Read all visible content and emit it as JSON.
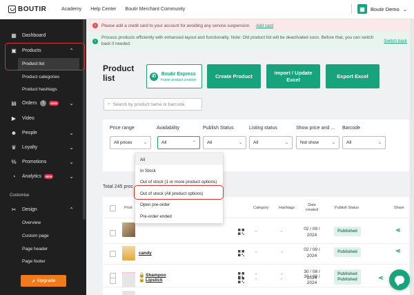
{
  "app": {
    "logo_text": "BOUTIR",
    "account_name": "Boutir Demo",
    "account_icon": "store-icon",
    "accent_color": "#17a37c"
  },
  "topnav": [
    "Academy",
    "Help Center",
    "Boutir Merchant Community"
  ],
  "sidebar": {
    "items": [
      {
        "label": "Dashboard",
        "icon": "dashboard-icon"
      },
      {
        "label": "Products",
        "icon": "products-icon"
      },
      {
        "label": "Orders",
        "icon": "orders-icon",
        "badge": "NEW"
      },
      {
        "label": "Video",
        "icon": "video-icon"
      },
      {
        "label": "People",
        "icon": "people-icon"
      },
      {
        "label": "Loyalty",
        "icon": "loyalty-icon"
      },
      {
        "label": "Promotions",
        "icon": "promotions-icon"
      },
      {
        "label": "Analytics",
        "icon": "analytics-icon",
        "badge": "NEW"
      },
      {
        "label": "Design",
        "icon": "design-icon"
      }
    ],
    "product_sub": [
      "Product list",
      "Product categories",
      "Product hashtags"
    ],
    "section_label": "Customise",
    "design_sub": [
      "Overview",
      "Custom page",
      "Page header",
      "Page footer"
    ],
    "upgrade_label": "Upgrade"
  },
  "notices": {
    "credit": "Please add a credit card to your account for avoiding any service suspension.",
    "credit_link": "Add card",
    "process": "Process products efficiently with enhanced layout and functionality. Note: Old product list will be deactivated soon. Before that, you can switch back if needed.",
    "process_link": "Switch back"
  },
  "page": {
    "title": "Product list"
  },
  "buttons": {
    "wa_title": "Boutir Express",
    "wa_sub": "Faster product creation",
    "create": "Create Product",
    "import": "Import / Update Excel",
    "export": "Export Excel"
  },
  "search": {
    "placeholder": "Search by product name or barcode."
  },
  "filters": [
    {
      "label": "Price range",
      "value": "All prices"
    },
    {
      "label": "Availability",
      "value": "All"
    },
    {
      "label": "Publish Status",
      "value": "All"
    },
    {
      "label": "Listing status",
      "value": "All"
    },
    {
      "label": "Show price and ...",
      "value": "Not show"
    },
    {
      "label": "Barcode",
      "value": "All"
    }
  ],
  "availability_options": [
    "All",
    "In Stock",
    "Out of stock (1 or more product options)",
    "Out of stock (All product options)",
    "Open pre-order",
    "Pre-order ended"
  ],
  "total_label": "Total 245 proc",
  "table": {
    "headers": {
      "product": "Prod",
      "category": "Category",
      "hashtags": "Hashtags",
      "date_l1": "Date",
      "date_l2": "created",
      "publish": "Publish Status",
      "share": "Share"
    },
    "rows": [
      {
        "name": "",
        "category": "-",
        "hashtags": "-",
        "date_l1": "02 / 09 /",
        "date_l2": "2024",
        "status": "Published"
      },
      {
        "name": "candy",
        "category": "-",
        "hashtags": "-",
        "date_l1": "02 / 09 /",
        "date_l2": "2024",
        "status": "Published"
      },
      {
        "name": "Shampoo",
        "category": "-",
        "hashtags": "-",
        "date_l1": "30 / 08 /",
        "date_l2": "2024",
        "status": "Published"
      },
      {
        "name": "Lipstick",
        "category": "-",
        "hashtags": "-",
        "date_l1": "30 / 08 /",
        "date_l2": "2024",
        "status": "Published"
      }
    ]
  }
}
